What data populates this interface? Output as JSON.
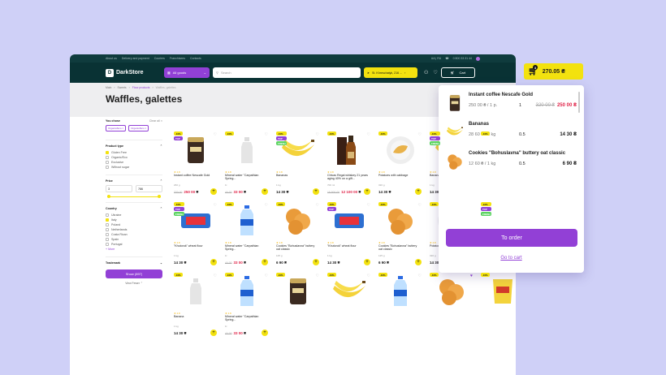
{
  "topbar": {
    "links": [
      "About us",
      "Delivery and payment",
      "Couriers",
      "Franchisees",
      "Contacts"
    ],
    "lang": "UA | RU",
    "phone": "0 800 33 31 44"
  },
  "nav": {
    "logo": "DarkStore",
    "all_goods": "All goods",
    "search_placeholder": "Search",
    "address": "St. Khreschatyk, 216 ...",
    "cart_label": "Cart"
  },
  "breadcrumbs": [
    "Main",
    "Sweets",
    "Flour products",
    "Waffles, galettes"
  ],
  "page_title": "Waffles, galettes",
  "filters": {
    "you_chose": "You chose",
    "clear_all": "Clear all",
    "chips": [
      "Organic/Eco",
      "Organic/Eco"
    ],
    "product_type": "Product type",
    "types": [
      {
        "label": "Gluten Free",
        "checked": true
      },
      {
        "label": "Organic/Eco",
        "checked": false
      },
      {
        "label": "Exclusive",
        "checked": false
      },
      {
        "label": "Without sugar",
        "checked": false
      }
    ],
    "price": "Price",
    "price_from": "3",
    "price_to": "786",
    "country": "Country",
    "countries": [
      {
        "label": "Ukraine",
        "checked": false
      },
      {
        "label": "Italy",
        "checked": true
      },
      {
        "label": "Poland",
        "checked": false
      },
      {
        "label": "Netherlands",
        "checked": false
      },
      {
        "label": "Costa Rican",
        "checked": false
      },
      {
        "label": "Spain",
        "checked": false
      },
      {
        "label": "Portugal",
        "checked": false
      }
    ],
    "more": "+ More",
    "trademark": "Trademark",
    "show_button": "Show (897)",
    "view_fewer": "View Fewer"
  },
  "sort": "Popular",
  "products": [
    {
      "name": "Instant coffee Nescafe Gold",
      "weight": "260 g",
      "old": "320 00",
      "price": "250 00",
      "red": true,
      "badges": [
        "-10%",
        "TOP"
      ],
      "img": "coffee",
      "heart": false
    },
    {
      "name": "Mineral water \"Carpathian Spring...",
      "weight": "1l",
      "old": "44 00",
      "price": "33 00",
      "red": true,
      "badges": [
        "-10%"
      ],
      "img": "bottle",
      "heart": false
    },
    {
      "name": "Bananas",
      "weight": "1 kg",
      "old": "",
      "price": "14 30",
      "red": false,
      "badges": [
        "-10%",
        "TOP",
        "FRESH"
      ],
      "img": "banana",
      "heart": false
    },
    {
      "name": "Chivas Regal whiskey 21 years aging 40% on a gift...",
      "weight": "700 ml",
      "old": "15 500 00",
      "price": "12 100 00",
      "red": true,
      "badges": [
        "-10%"
      ],
      "img": "whisky",
      "heart": false
    },
    {
      "name": "Potatoes with cabbage",
      "weight": "320 g",
      "old": "",
      "price": "14 30",
      "red": false,
      "badges": [
        "-10%"
      ],
      "img": "plate",
      "heart": false
    },
    {
      "name": "Bananas",
      "weight": "1 kg",
      "old": "",
      "price": "14 30",
      "red": false,
      "badges": [
        "-10%",
        "TOP",
        "FRESH"
      ],
      "img": "banana",
      "heart": false
    },
    {
      "name": "Potatoes with cabbage",
      "weight": "320 g",
      "old": "",
      "price": "14 90",
      "red": false,
      "badges": [
        "-10%"
      ],
      "img": "plate",
      "heart": true
    },
    {
      "name": "\"Khutorok\" wheat flour",
      "weight": "1 kg",
      "old": "",
      "price": "14 30",
      "red": false,
      "badges": [
        "-10%",
        "TOP",
        "FRESH"
      ],
      "img": "flour",
      "heart": false
    },
    {
      "name": "Mineral water \"Carpathian Spring...",
      "weight": "1l",
      "old": "44 00",
      "price": "33 00",
      "red": true,
      "badges": [
        "-10%"
      ],
      "img": "water",
      "heart": false
    },
    {
      "name": "Cookies \"Bohuslavna\" buttery oat classic",
      "weight": "125 g",
      "old": "",
      "price": "6 90",
      "red": false,
      "badges": [
        "-10%"
      ],
      "img": "cookies",
      "heart": false
    },
    {
      "name": "\"Khutorok\" wheat flour",
      "weight": "1 kg",
      "old": "",
      "price": "14 30",
      "red": false,
      "badges": [
        "-10%",
        "TOP"
      ],
      "img": "flour",
      "heart": false
    },
    {
      "name": "Cookies \"Bohuslavna\" buttery oat classic",
      "weight": "125 g",
      "old": "",
      "price": "6 90",
      "red": false,
      "badges": [
        "-10%"
      ],
      "img": "cookies",
      "heart": false
    },
    {
      "name": "Potatoes with cabbage",
      "weight": "320 g",
      "old": "",
      "price": "14 30",
      "red": false,
      "badges": [
        "-10%"
      ],
      "img": "plate",
      "heart": false
    },
    {
      "name": "Instant coffee Nescafe Gold",
      "weight": "260 g",
      "old": "320 00",
      "price": "250 00",
      "red": true,
      "badges": [
        "-10%",
        "TOP",
        "FRESH"
      ],
      "img": "coffee",
      "heart": true
    },
    {
      "name": "Banana",
      "weight": "1 kg",
      "old": "",
      "price": "14 30",
      "red": false,
      "badges": [
        "-10%"
      ],
      "img": "bottle",
      "heart": false
    },
    {
      "name": "Mineral water \"Carpathian Spring...",
      "weight": "1l",
      "old": "44 00",
      "price": "33 00",
      "red": true,
      "badges": [
        "-10%"
      ],
      "img": "water",
      "heart": false
    },
    {
      "name": "",
      "weight": "",
      "old": "",
      "price": "",
      "red": false,
      "badges": [
        "-10%"
      ],
      "img": "coffee",
      "heart": false
    },
    {
      "name": "",
      "weight": "",
      "old": "",
      "price": "",
      "red": false,
      "badges": [
        "-10%"
      ],
      "img": "banana",
      "heart": false
    },
    {
      "name": "",
      "weight": "",
      "old": "",
      "price": "",
      "red": false,
      "badges": [
        "-10%"
      ],
      "img": "water",
      "heart": false
    },
    {
      "name": "",
      "weight": "",
      "old": "",
      "price": "",
      "red": false,
      "badges": [
        "-10%"
      ],
      "img": "cookies",
      "heart": true
    },
    {
      "name": "",
      "weight": "",
      "old": "",
      "price": "",
      "red": false,
      "badges": [
        "-10%"
      ],
      "img": "chips",
      "heart": false
    }
  ],
  "minicart": {
    "count": "3",
    "total": "270.05",
    "currency": "₴"
  },
  "cart_items": [
    {
      "title": "Instant coffee Nescafe Gold",
      "unit": "250 00 ₴ / 1 p.",
      "qty": "1",
      "old": "320 00 ₴",
      "price": "250 00 ₴",
      "img": "coffee"
    },
    {
      "title": "Bananas",
      "unit": "28 60 ₴ / 1 kg",
      "qty": "0.5",
      "old": "",
      "price": "14 30 ₴",
      "img": "banana"
    },
    {
      "title": "Cookies \"Bohuslavna\" buttery oat classic",
      "unit": "12 60 ₴ / 1 kg",
      "qty": "0.5",
      "old": "",
      "price": "6 90 ₴",
      "img": "cookies"
    }
  ],
  "order_button": "To order",
  "go_to_cart": "Go to cart"
}
